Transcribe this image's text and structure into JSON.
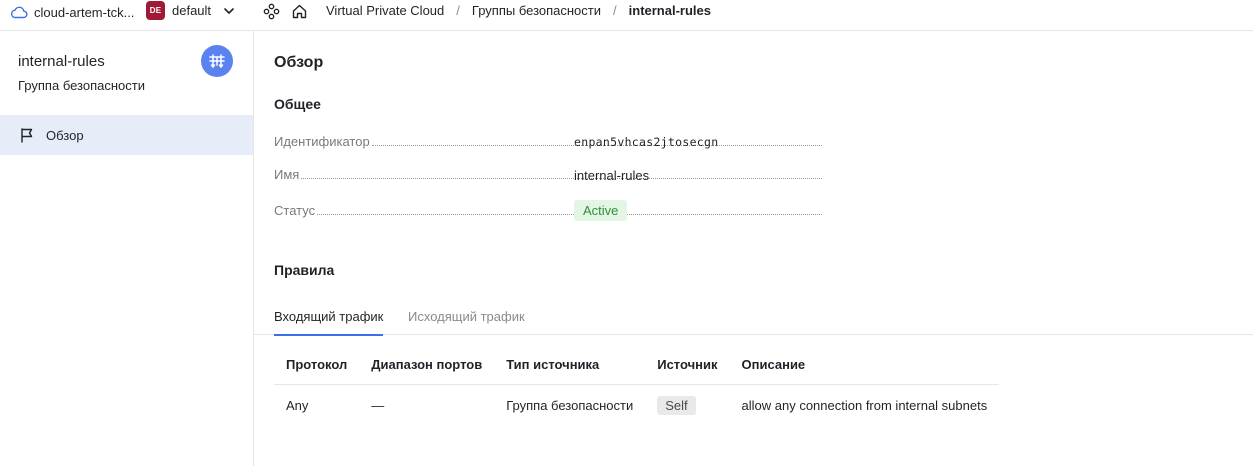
{
  "header": {
    "cloud_name": "cloud-artem-tck...",
    "folder_badge": "DE",
    "folder_name": "default",
    "breadcrumbs": [
      "Virtual Private Cloud",
      "Группы безопасности",
      "internal-rules"
    ],
    "separator": "/"
  },
  "sidebar": {
    "title": "internal-rules",
    "subtitle": "Группа безопасности",
    "items": [
      {
        "label": "Обзор",
        "icon": "flag-icon"
      }
    ]
  },
  "main": {
    "overview_title": "Обзор",
    "general_title": "Общее",
    "fields": {
      "id_label": "Идентификатор",
      "id_value": "enpan5vhcas2jtosecgn",
      "name_label": "Имя",
      "name_value": "internal-rules",
      "status_label": "Статус",
      "status_value": "Active"
    },
    "rules_title": "Правила",
    "tabs": [
      {
        "label": "Входящий трафик"
      },
      {
        "label": "Исходящий трафик"
      }
    ],
    "table": {
      "headers": [
        "Протокол",
        "Диапазон портов",
        "Тип источника",
        "Источник",
        "Описание"
      ],
      "rows": [
        [
          "Any",
          "—",
          "Группа безопасности",
          "Self",
          "allow any connection from internal subnets"
        ]
      ]
    }
  },
  "colors": {
    "accent": "#3a71e8",
    "folder_badge_bg": "#9f1a35",
    "avatar_bg": "#5a82f1",
    "status_bg": "#e3f5e3",
    "status_text": "#2f8f3a",
    "sidebar_active_bg": "#e6ecf8"
  }
}
